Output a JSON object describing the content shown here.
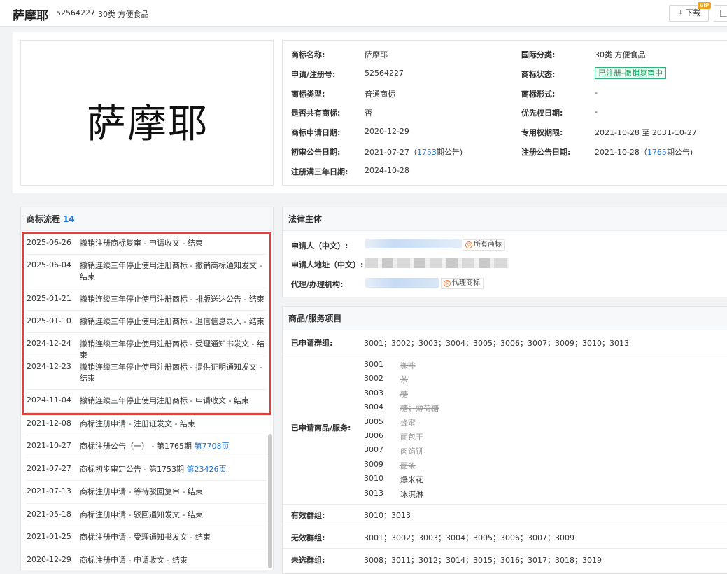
{
  "header": {
    "title": "萨摩耶",
    "reg_no": "52564227",
    "class": "30类 方便食品",
    "download_label": "下载",
    "vip_label": "VIP"
  },
  "logo_text": "萨摩耶",
  "info": {
    "name_label": "商标名称:",
    "name_value": "萨摩耶",
    "intl_class_label": "国际分类:",
    "intl_class_value": "30类 方便食品",
    "regno_label": "申请/注册号:",
    "regno_value": "52564227",
    "status_label": "商标状态:",
    "status_value": "已注册-撤销复审中",
    "type_label": "商标类型:",
    "type_value": "普通商标",
    "form_label": "商标形式:",
    "form_value": "-",
    "shared_label": "是否共有商标:",
    "shared_value": "否",
    "priority_label": "优先权日期:",
    "priority_value": "-",
    "apply_date_label": "商标申请日期:",
    "apply_date_value": "2020-12-29",
    "exclusive_label": "专用权期限:",
    "exclusive_value": "2021-10-28 至 2031-10-27",
    "prelim_label": "初审公告日期:",
    "prelim_date": "2021-07-27",
    "prelim_open": "（",
    "prelim_issue": "1753",
    "prelim_close": "期公告)",
    "regpub_label": "注册公告日期:",
    "regpub_date": "2021-10-28",
    "regpub_open": "（",
    "regpub_issue": "1765",
    "regpub_close": "期公告)",
    "three_year_label": "注册满三年日期:",
    "three_year_value": "2024-10-28"
  },
  "flow": {
    "title": "商标流程",
    "count": "14",
    "items": [
      {
        "date": "2025-06-26",
        "desc": "撤销注册商标复审 - 申请收文 - 结束"
      },
      {
        "date": "2025-06-04",
        "desc": "撤销连续三年停止使用注册商标 - 撤销商标通知发文 - 结束"
      },
      {
        "date": "2025-01-21",
        "desc": "撤销连续三年停止使用注册商标 - 排版送达公告 - 结束"
      },
      {
        "date": "2025-01-10",
        "desc": "撤销连续三年停止使用注册商标 - 退信信息录入 - 结束"
      },
      {
        "date": "2024-12-24",
        "desc": "撤销连续三年停止使用注册商标 - 受理通知书发文 - 结束"
      },
      {
        "date": "2024-12-23",
        "desc": "撤销连续三年停止使用注册商标 - 提供证明通知发文 - 结束"
      },
      {
        "date": "2024-11-04",
        "desc": "撤销连续三年停止使用注册商标 - 申请收文 - 结束"
      },
      {
        "date": "2021-12-08",
        "desc": "商标注册申请 - 注册证发文 - 结束"
      },
      {
        "date": "2021-10-27",
        "desc": "商标注册公告（一） - 第1765期 ",
        "link": "第7708页"
      },
      {
        "date": "2021-07-27",
        "desc": "商标初步审定公告 - 第1753期 ",
        "link": "第23426页"
      },
      {
        "date": "2021-07-13",
        "desc": "商标注册申请 - 等待驳回复审 - 结束"
      },
      {
        "date": "2021-05-18",
        "desc": "商标注册申请 - 驳回通知发文 - 结束"
      },
      {
        "date": "2021-01-25",
        "desc": "商标注册申请 - 受理通知书发文 - 结束"
      },
      {
        "date": "2020-12-29",
        "desc": "商标注册申请 - 申请收文 - 结束"
      }
    ]
  },
  "legal": {
    "title": "法律主体",
    "applicant_label": "申请人（中文）:",
    "applicant_tag": "所有商标",
    "address_label": "申请人地址（中文）:",
    "agent_label": "代理/办理机构:",
    "agent_tag": "代理商标"
  },
  "goods": {
    "title": "商品/服务项目",
    "groups_label": "已申请群组:",
    "groups_value": "3001；3002；3003；3004；3005；3006；3007；3009；3010；3013",
    "items_label": "已申请商品/服务:",
    "items": [
      {
        "code": "3001",
        "name": "咖啡",
        "struck": true
      },
      {
        "code": "3002",
        "name": "茶",
        "struck": true
      },
      {
        "code": "3003",
        "name": "糖",
        "struck": true
      },
      {
        "code": "3004",
        "name": "糖；薄荷糖",
        "struck": true
      },
      {
        "code": "3005",
        "name": "蜂蜜",
        "struck": true
      },
      {
        "code": "3006",
        "name": "面包干",
        "struck": true
      },
      {
        "code": "3007",
        "name": "肉馅饼",
        "struck": true
      },
      {
        "code": "3009",
        "name": "面条",
        "struck": true
      },
      {
        "code": "3010",
        "name": "爆米花",
        "struck": false
      },
      {
        "code": "3013",
        "name": "冰淇淋",
        "struck": false
      }
    ],
    "valid_label": "有效群组:",
    "valid_value": "3010；3013",
    "invalid_label": "无效群组:",
    "invalid_value": "3001；3002；3003；3004；3005；3006；3007；3009",
    "unselected_label": "未选群组:",
    "unselected_value": "3008；3011；3012；3014；3015；3016；3017；3018；3019"
  }
}
